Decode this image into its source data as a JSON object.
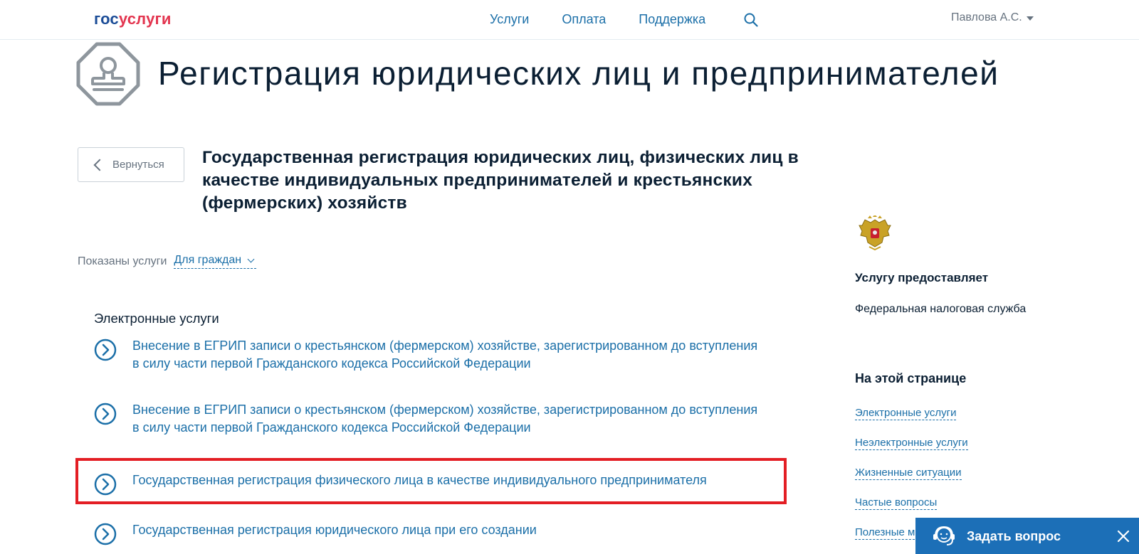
{
  "header": {
    "logo_part1": "гос",
    "logo_part2": "услуги",
    "nav": [
      "Услуги",
      "Оплата",
      "Поддержка"
    ],
    "user_name": "Павлова А.С."
  },
  "page": {
    "title": "Регистрация юридических лиц и предпринимателей",
    "back_label": "Вернуться",
    "service_title": "Государственная регистрация юридических лиц, физических лиц в качестве индивидуальных предпринимателей и крестьянских (фермерских) хозяйств"
  },
  "filter": {
    "label": "Показаны услуги",
    "value": "Для граждан"
  },
  "electronic": {
    "heading": "Электронные услуги",
    "items": [
      "Внесение в ЕГРИП записи о крестьянском (фермерском) хозяйстве, зарегистрированном до вступления в силу части первой Гражданского кодекса Российской Федерации",
      "Внесение в ЕГРИП записи о крестьянском (фермерском) хозяйстве, зарегистрированном до вступления в силу части первой Гражданского кодекса Российской Федерации",
      "Государственная регистрация физического лица в качестве индивидуального предпринимателя",
      "Государственная регистрация юридического лица при его создании"
    ]
  },
  "sidebar": {
    "provider_heading": "Услугу предоставляет",
    "provider": "Федеральная налоговая служба",
    "onpage_heading": "На этой странице",
    "links": [
      "Электронные услуги",
      "Неэлектронные услуги",
      "Жизненные ситуации",
      "Частые вопросы",
      "Полезные м"
    ]
  },
  "ask_widget": {
    "label": "Задать вопрос"
  },
  "colors": {
    "link": "#1b6fa8",
    "highlight": "#e31e24",
    "widget": "#1c6fb7"
  }
}
